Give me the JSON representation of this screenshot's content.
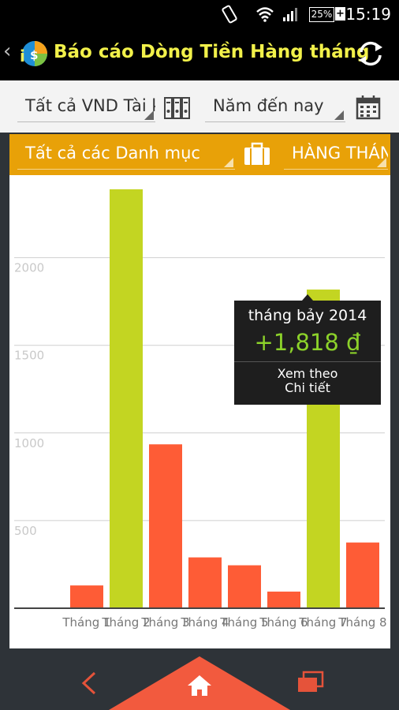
{
  "status_bar": {
    "battery": "25%",
    "battery_plus": "+",
    "time": "15:19"
  },
  "header": {
    "back_glyph": "‹",
    "title": "Báo cáo Dòng Tiền Hàng tháng"
  },
  "filters": {
    "account": "Tất cả VND Tài khoản",
    "period": "Năm đến nay",
    "category": "Tất cả các Danh mục",
    "frequency": "HÀNG THÁNG"
  },
  "chart_data": {
    "type": "bar",
    "categories": [
      "Tháng 1",
      "Tháng 2",
      "Tháng 3",
      "Tháng 4",
      "Tháng 5",
      "Tháng 6",
      "Tháng 7",
      "Tháng 8"
    ],
    "values": [
      130,
      2390,
      935,
      290,
      245,
      95,
      1818,
      375
    ],
    "signs": [
      "negative",
      "positive",
      "negative",
      "negative",
      "negative",
      "negative",
      "positive",
      "negative"
    ],
    "colors": {
      "positive": "#c3d522",
      "negative": "#fe5c36"
    },
    "yticks": [
      500,
      1000,
      1500,
      2000
    ],
    "ylim": [
      0,
      2400
    ],
    "grid": true
  },
  "tooltip": {
    "month": "tháng bảy 2014",
    "amount": "+1,818 ₫",
    "action_line1": "Xem theo",
    "action_line2": "Chi tiết"
  },
  "nav": {
    "back": "back-icon",
    "home": "home-icon",
    "recent": "recent-apps-icon"
  }
}
